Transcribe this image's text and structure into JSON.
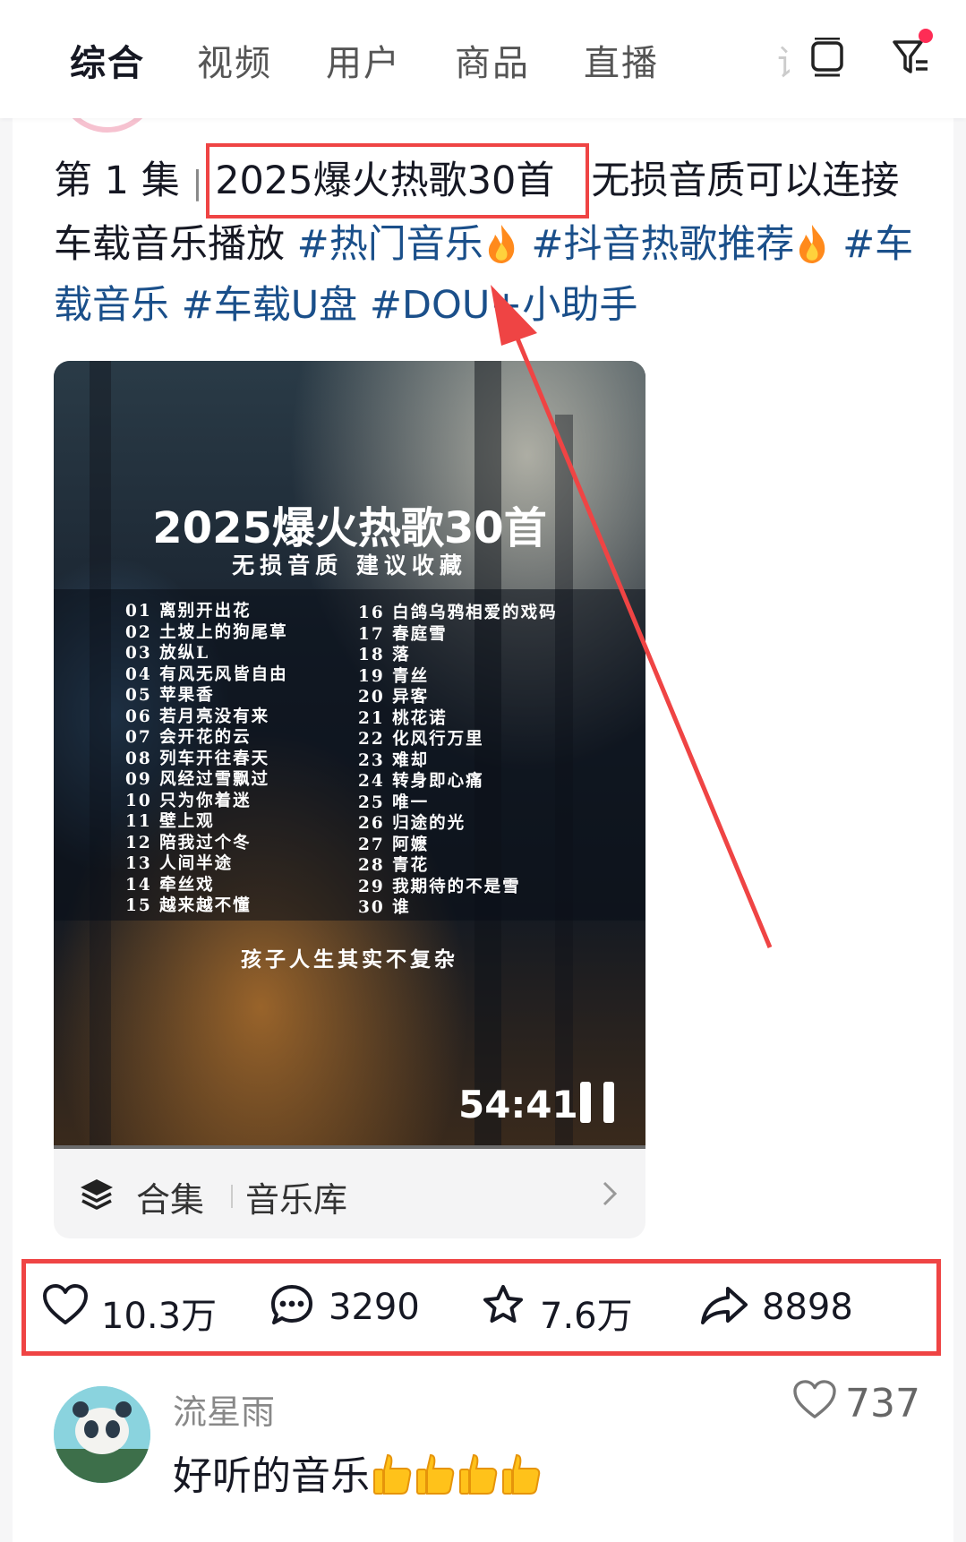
{
  "tabs": [
    {
      "label": "综合",
      "active": true
    },
    {
      "label": "视频",
      "active": false
    },
    {
      "label": "用户",
      "active": false
    },
    {
      "label": "商品",
      "active": false
    },
    {
      "label": "直播",
      "active": false
    },
    {
      "label": "话",
      "active": false
    }
  ],
  "top_icons": [
    "device-icon",
    "filter-icon"
  ],
  "post": {
    "episode": "第 1 集",
    "separator": "|",
    "title": "2025爆火热歌30首",
    "desc_rest": "无损音质可以连接车载音乐播放",
    "hashtags": [
      "#热门音乐",
      "#抖音热歌推荐",
      "#车载音乐",
      "#车载U盘",
      "#DOU+小助手"
    ]
  },
  "video": {
    "title": "2025爆火热歌30首",
    "subtitle": "无损音质  建议收藏",
    "songs_left": [
      "01 离别开出花",
      "02 土坡上的狗尾草",
      "03 放纵L",
      "04 有风无风皆自由",
      "05 苹果香",
      "06 若月亮没有来",
      "07 会开花的云",
      "08 列车开往春天",
      "09 风经过雪飘过",
      "10 只为你着迷",
      "11 壁上观",
      "12 陪我过个冬",
      "13 人间半途",
      "14 牵丝戏",
      "15 越来越不懂"
    ],
    "songs_right": [
      "16 白鸽乌鸦相爱的戏码",
      "17 春庭雪",
      "18 落",
      "19 青丝",
      "20 异客",
      "21 桃花诺",
      "22 化风行万里",
      "23 难却",
      "24 转身即心痛",
      "25 唯一",
      "26 归途的光",
      "27 阿嬷",
      "28 青花",
      "29 我期待的不是雪",
      "30 谁"
    ],
    "footer": "孩子人生其实不复杂",
    "duration": "54:41"
  },
  "collection": {
    "label": "合集",
    "name": "音乐库"
  },
  "actions": {
    "likes": "10.3万",
    "comments": "3290",
    "favorites": "7.6万",
    "shares": "8898"
  },
  "comment": {
    "username": "流星雨",
    "text": "好听的音乐",
    "likes": "737"
  },
  "colors": {
    "highlight": "#ef4444",
    "hashtag": "#1a4f8a",
    "notification": "#fe2c55"
  }
}
